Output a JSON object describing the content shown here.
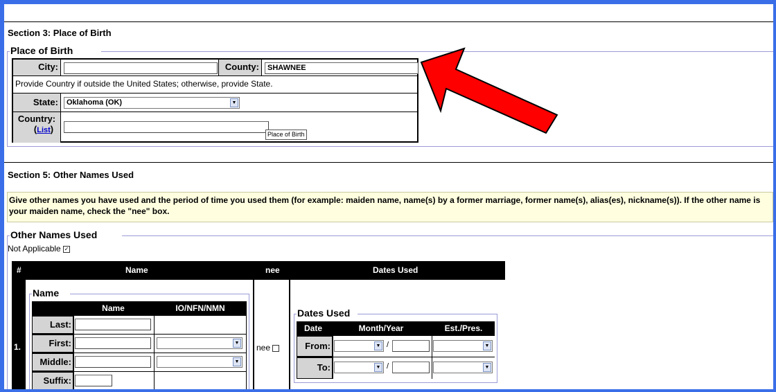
{
  "section3": {
    "title": "Section 3: Place of Birth",
    "legend": "Place of Birth",
    "city_label": "City:",
    "city_value": "",
    "county_label": "County:",
    "county_value": "SHAWNEE",
    "instruction": "Provide Country if outside the United States; otherwise, provide State.",
    "state_label": "State:",
    "state_value": "Oklahoma (OK)",
    "country_label": "Country:",
    "country_link": "List",
    "country_value": "",
    "tooltip": "Place of Birth"
  },
  "section5": {
    "title": "Section 5: Other Names Used",
    "instruction": "Give other names you have used and the period of time you used them (for example: maiden name, name(s) by a former marriage, former name(s), alias(es), nickname(s)). If the other name is your maiden name, check the \"nee\" box.",
    "legend": "Other Names Used",
    "not_applicable_label": "Not Applicable",
    "not_applicable_checked": true,
    "table": {
      "headers": [
        "#",
        "Name",
        "nee",
        "Dates Used"
      ],
      "row_number": "1.",
      "name_legend": "Name",
      "name_subheaders": [
        "Name",
        "IO/NFN/NMN"
      ],
      "name_fields": [
        "Last:",
        "First:",
        "Middle:",
        "Suffix:"
      ],
      "nee_label": "nee",
      "dates_legend": "Dates Used",
      "dates_subheaders": [
        "Date",
        "Month/Year",
        "Est./Pres."
      ],
      "date_rows": [
        "From:",
        "To:"
      ],
      "slash": "/"
    }
  },
  "annotation": {
    "arrow_color": "#ff0000",
    "arrow_points_to": "county-field"
  },
  "colors": {
    "window_border": "#3a6ee8",
    "instruction_bg": "#ffffe0",
    "label_bg": "#d6d6d6"
  }
}
